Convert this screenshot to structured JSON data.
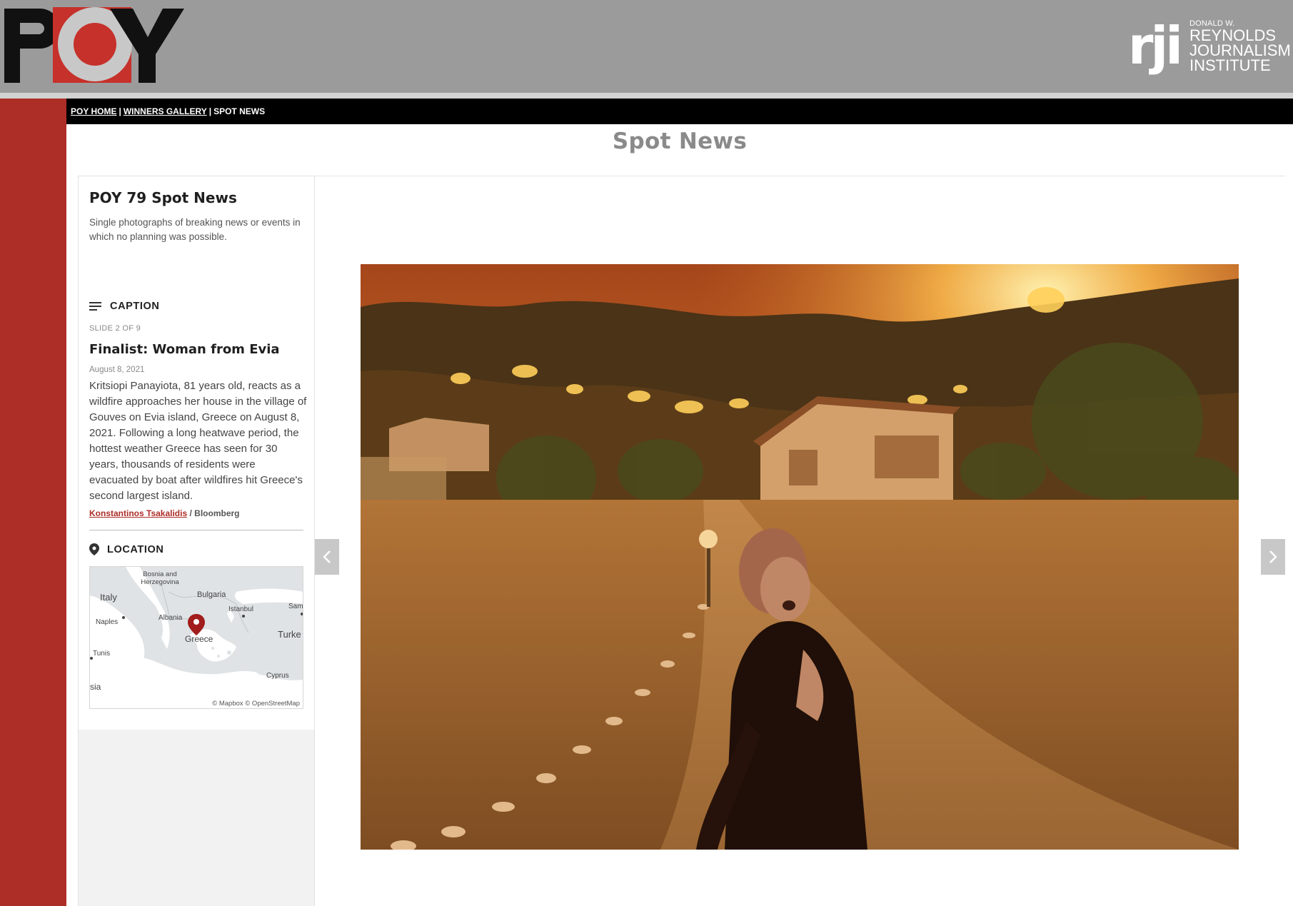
{
  "header": {
    "poy_logo_text": "POY",
    "rji_mark": "rji",
    "rji_line1": "DONALD W.",
    "rji_line2": "REYNOLDS",
    "rji_line3": "JOURNALISM",
    "rji_line4": "INSTITUTE"
  },
  "breadcrumb": {
    "home": "POY HOME",
    "gallery": "WINNERS GALLERY",
    "current": "SPOT NEWS",
    "separator": "|"
  },
  "page_title": "Spot News",
  "sidebar": {
    "title": "POY 79 Spot News",
    "description": "Single photographs of breaking news or events in which no planning was possible.",
    "caption_heading": "CAPTION",
    "slide_counter": "SLIDE 2 OF 9",
    "caption_title": "Finalist: Woman from Evia",
    "date": "August 8, 2021",
    "caption_text": "Kritsiopi Panayiota, 81 years old, reacts as a wildfire approaches her house in the village of Gouves on Evia island, Greece on August 8, 2021. Following a long heatwave period, the hottest weather Greece has seen for 30 years, thousands of residents were evacuated by boat after wildfires hit Greece's second largest island.",
    "photographer": "Konstantinos Tsakalidis",
    "credit_separator": "/",
    "agency": "Bloomberg",
    "location_heading": "LOCATION"
  },
  "map": {
    "labels": {
      "bosnia": "Bosnia and Herzegovina",
      "italy": "Italy",
      "bulgaria": "Bulgaria",
      "istanbul": "Istanbul",
      "samsun": "Sam",
      "naples": "Naples",
      "albania": "Albania",
      "greece": "Greece",
      "turkey": "Turke",
      "tunis": "Tunis",
      "cyprus": "Cyprus",
      "tunisia": "sia"
    },
    "attribution": "© Mapbox © OpenStreetMap",
    "colors": {
      "land": "#dfe3e5",
      "sea": "#ffffff",
      "pin": "#a21d1d"
    }
  },
  "photo": {
    "icons": {
      "prev": "chevron-left-icon",
      "next": "chevron-right-icon"
    }
  },
  "colors": {
    "header_bg": "#9b9b9b",
    "accent_red": "#ad2d27",
    "breadcrumb_bg": "#000000",
    "title_gray": "#8a8a8a"
  }
}
